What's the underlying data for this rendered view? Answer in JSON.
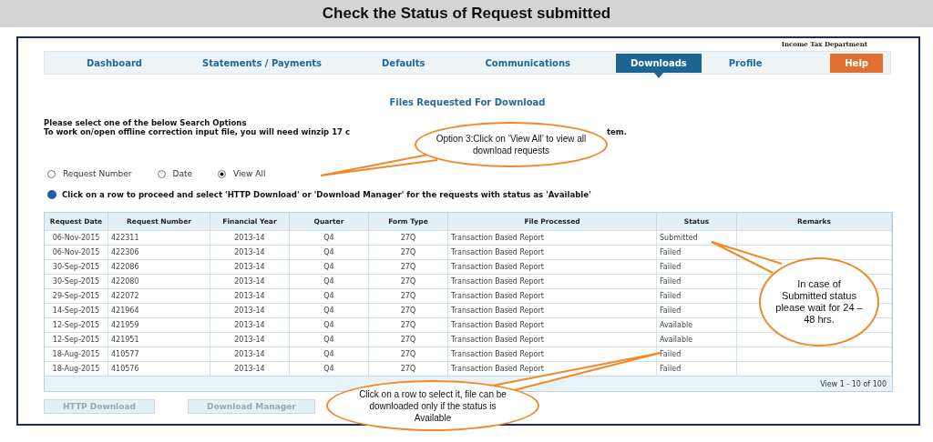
{
  "slide_title": "Check the Status of Request submitted",
  "brand": "Income Tax Department",
  "nav": [
    {
      "label": "Dashboard",
      "selected": false,
      "kind": "tab"
    },
    {
      "label": "Statements / Payments",
      "selected": false,
      "kind": "tab"
    },
    {
      "label": "Defaults",
      "selected": false,
      "kind": "tab"
    },
    {
      "label": "Communications",
      "selected": false,
      "kind": "tab"
    },
    {
      "label": "Downloads",
      "selected": true,
      "kind": "tab"
    },
    {
      "label": "Profile",
      "selected": false,
      "kind": "tab"
    },
    {
      "label": "Help",
      "selected": false,
      "kind": "help"
    }
  ],
  "heading": "Files Requested For Download",
  "instructions": [
    "Please select one of the below Search Options",
    "To work on/open offline correction input file, you will need winzip 17 c",
    "tem."
  ],
  "search_options": [
    {
      "label": "Request Number",
      "selected": false
    },
    {
      "label": "Date",
      "selected": false
    },
    {
      "label": "View All",
      "selected": true
    }
  ],
  "info": "Click on a row to proceed and select 'HTTP Download' or 'Download Manager' for the requests with status as 'Available'",
  "table": {
    "columns": [
      "Request Date",
      "Request Number",
      "Financial Year",
      "Quarter",
      "Form Type",
      "File Processed",
      "Status",
      "Remarks"
    ],
    "rows": [
      [
        "06-Nov-2015",
        "422311",
        "2013-14",
        "Q4",
        "27Q",
        "Transaction Based Report",
        "Submitted"
      ],
      [
        "06-Nov-2015",
        "422306",
        "2013-14",
        "Q4",
        "27Q",
        "Transaction Based Report",
        "Failed"
      ],
      [
        "30-Sep-2015",
        "422086",
        "2013-14",
        "Q4",
        "27Q",
        "Transaction Based Report",
        "Failed"
      ],
      [
        "30-Sep-2015",
        "422080",
        "2013-14",
        "Q4",
        "27Q",
        "Transaction Based Report",
        "Failed"
      ],
      [
        "29-Sep-2015",
        "422072",
        "2013-14",
        "Q4",
        "27Q",
        "Transaction Based Report",
        "Failed"
      ],
      [
        "14-Sep-2015",
        "421964",
        "2013-14",
        "Q4",
        "27Q",
        "Transaction Based Report",
        "Failed"
      ],
      [
        "12-Sep-2015",
        "421959",
        "2013-14",
        "Q4",
        "27Q",
        "Transaction Based Report",
        "Available"
      ],
      [
        "12-Sep-2015",
        "421951",
        "2013-14",
        "Q4",
        "27Q",
        "Transaction Based Report",
        "Available"
      ],
      [
        "18-Aug-2015",
        "410577",
        "2013-14",
        "Q4",
        "27Q",
        "Transaction Based Report",
        "Failed"
      ],
      [
        "18-Aug-2015",
        "410576",
        "2013-14",
        "Q4",
        "27Q",
        "Transaction Based Report",
        "Failed"
      ]
    ],
    "pager": "View 1 - 10 of 100"
  },
  "buttons": [
    {
      "label": "HTTP Download",
      "disabled": true
    },
    {
      "label": "Download Manager",
      "disabled": true
    }
  ],
  "callouts": [
    {
      "text": "Option 3:Click on ‘View All’ to view all download requests"
    },
    {
      "text": "In case of Submitted status please wait for 24 – 48 hrs."
    },
    {
      "text": "Click on a row to select it, file can be downloaded only if the status is Available"
    }
  ]
}
